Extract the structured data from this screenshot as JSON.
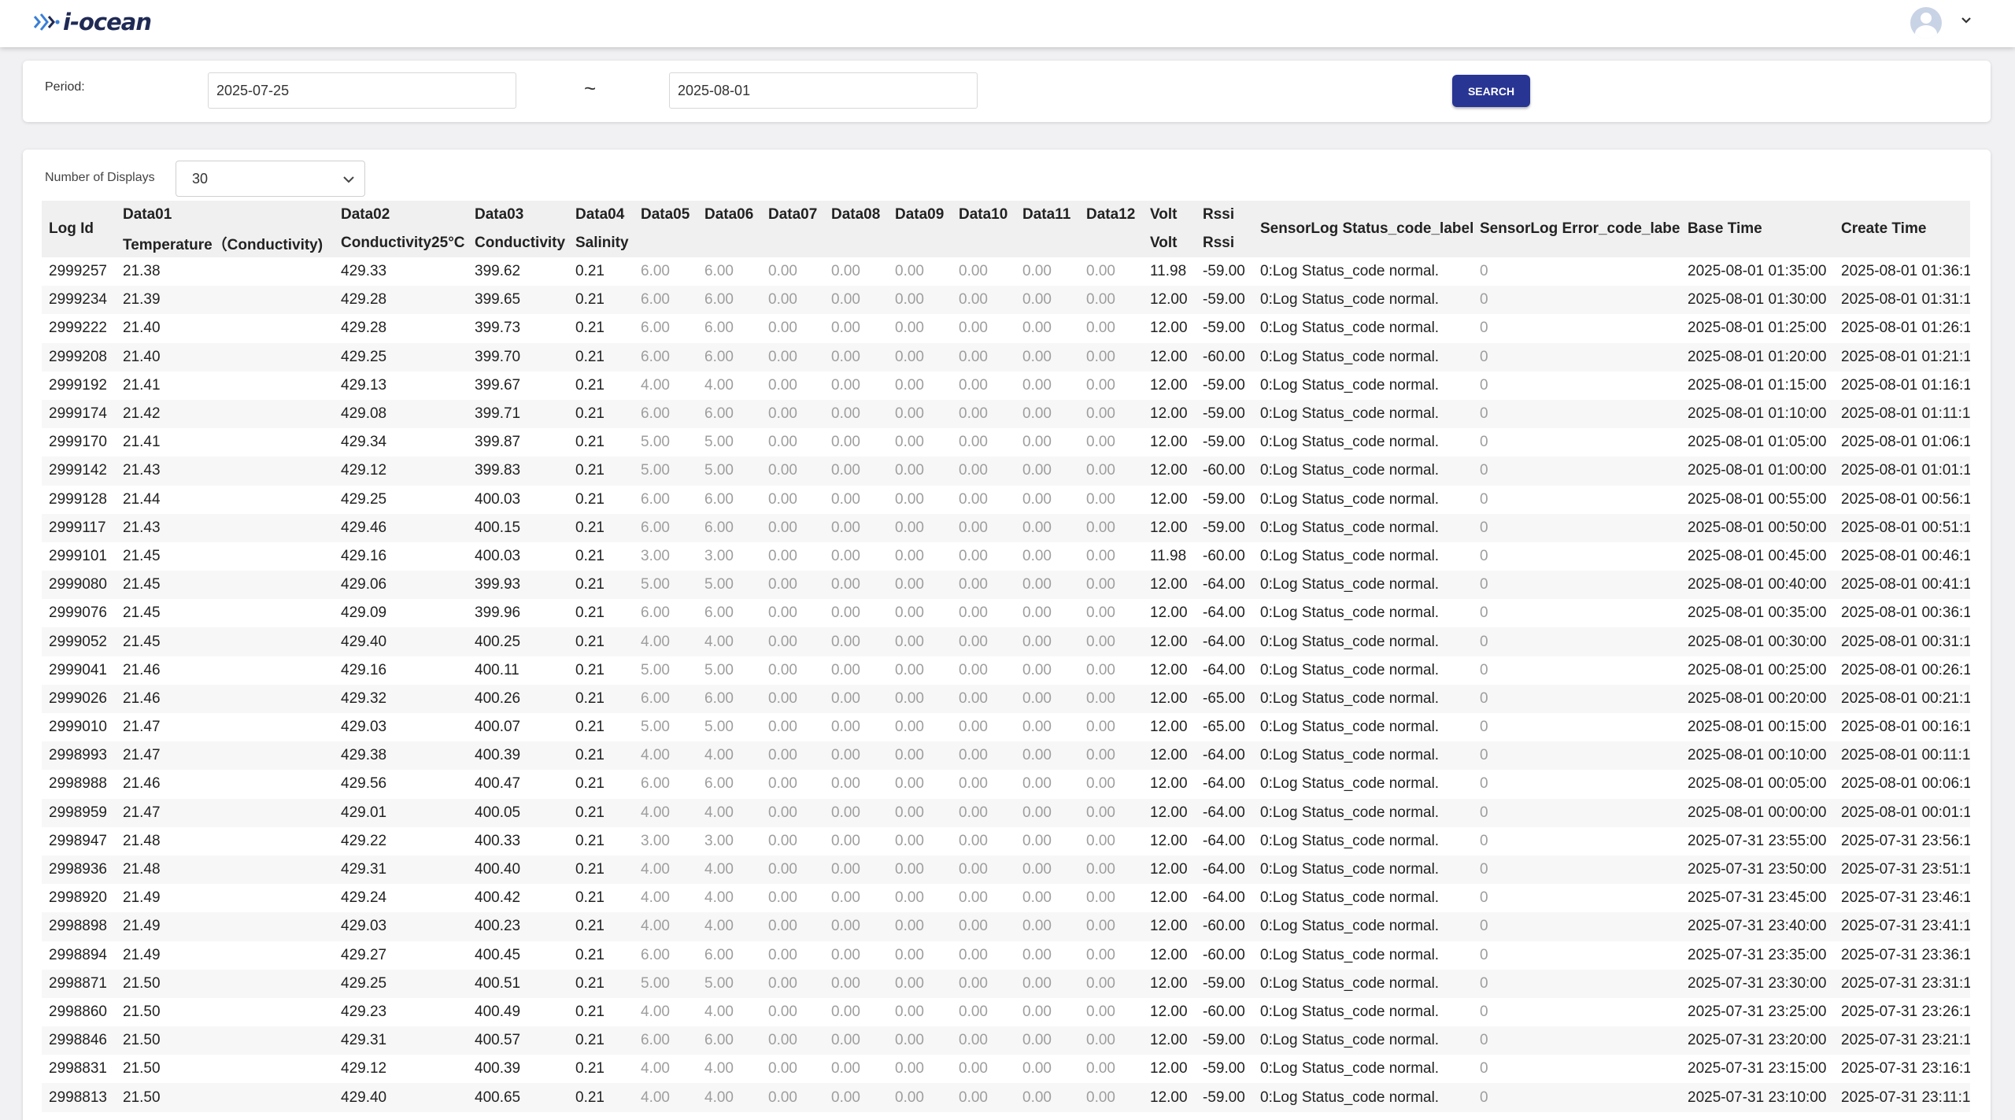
{
  "brand": {
    "name": "i-ocean"
  },
  "search": {
    "period_label": "Period:",
    "from_value": "2025-07-25",
    "separator": "~",
    "to_value": "2025-08-01",
    "button_label": "SEARCH"
  },
  "displays": {
    "label": "Number of Displays",
    "value": "30"
  },
  "table": {
    "headers": {
      "log_id": "Log Id",
      "data01": "Data01",
      "data01_sub": "Temperature（Conductivity)",
      "data02": "Data02",
      "data02_sub": "Conductivity25°C",
      "data03": "Data03",
      "data03_sub": "Conductivity",
      "data04": "Data04",
      "data04_sub": "Salinity",
      "data05": "Data05",
      "data06": "Data06",
      "data07": "Data07",
      "data08": "Data08",
      "data09": "Data09",
      "data10": "Data10",
      "data11": "Data11",
      "data12": "Data12",
      "volt": "Volt",
      "volt_sub": "Volt",
      "rssi": "Rssi",
      "rssi_sub": "Rssi",
      "status": "SensorLog Status_code_label.",
      "error": "SensorLog Error_code_label.",
      "base_time": "Base Time",
      "create_time": "Create Time"
    },
    "rows": [
      [
        "2999257",
        "21.38",
        "429.33",
        "399.62",
        "0.21",
        "6.00",
        "6.00",
        "0.00",
        "0.00",
        "0.00",
        "0.00",
        "0.00",
        "0.00",
        "11.98",
        "-59.00",
        "0:Log Status_code normal.",
        "0",
        "2025-08-01 01:35:00",
        "2025-08-01 01:36:1"
      ],
      [
        "2999234",
        "21.39",
        "429.28",
        "399.65",
        "0.21",
        "6.00",
        "6.00",
        "0.00",
        "0.00",
        "0.00",
        "0.00",
        "0.00",
        "0.00",
        "12.00",
        "-59.00",
        "0:Log Status_code normal.",
        "0",
        "2025-08-01 01:30:00",
        "2025-08-01 01:31:1"
      ],
      [
        "2999222",
        "21.40",
        "429.28",
        "399.73",
        "0.21",
        "6.00",
        "6.00",
        "0.00",
        "0.00",
        "0.00",
        "0.00",
        "0.00",
        "0.00",
        "12.00",
        "-59.00",
        "0:Log Status_code normal.",
        "0",
        "2025-08-01 01:25:00",
        "2025-08-01 01:26:1"
      ],
      [
        "2999208",
        "21.40",
        "429.25",
        "399.70",
        "0.21",
        "6.00",
        "6.00",
        "0.00",
        "0.00",
        "0.00",
        "0.00",
        "0.00",
        "0.00",
        "12.00",
        "-60.00",
        "0:Log Status_code normal.",
        "0",
        "2025-08-01 01:20:00",
        "2025-08-01 01:21:1"
      ],
      [
        "2999192",
        "21.41",
        "429.13",
        "399.67",
        "0.21",
        "4.00",
        "4.00",
        "0.00",
        "0.00",
        "0.00",
        "0.00",
        "0.00",
        "0.00",
        "12.00",
        "-59.00",
        "0:Log Status_code normal.",
        "0",
        "2025-08-01 01:15:00",
        "2025-08-01 01:16:1"
      ],
      [
        "2999174",
        "21.42",
        "429.08",
        "399.71",
        "0.21",
        "6.00",
        "6.00",
        "0.00",
        "0.00",
        "0.00",
        "0.00",
        "0.00",
        "0.00",
        "12.00",
        "-59.00",
        "0:Log Status_code normal.",
        "0",
        "2025-08-01 01:10:00",
        "2025-08-01 01:11:1"
      ],
      [
        "2999170",
        "21.41",
        "429.34",
        "399.87",
        "0.21",
        "5.00",
        "5.00",
        "0.00",
        "0.00",
        "0.00",
        "0.00",
        "0.00",
        "0.00",
        "12.00",
        "-59.00",
        "0:Log Status_code normal.",
        "0",
        "2025-08-01 01:05:00",
        "2025-08-01 01:06:1"
      ],
      [
        "2999142",
        "21.43",
        "429.12",
        "399.83",
        "0.21",
        "5.00",
        "5.00",
        "0.00",
        "0.00",
        "0.00",
        "0.00",
        "0.00",
        "0.00",
        "12.00",
        "-60.00",
        "0:Log Status_code normal.",
        "0",
        "2025-08-01 01:00:00",
        "2025-08-01 01:01:1"
      ],
      [
        "2999128",
        "21.44",
        "429.25",
        "400.03",
        "0.21",
        "6.00",
        "6.00",
        "0.00",
        "0.00",
        "0.00",
        "0.00",
        "0.00",
        "0.00",
        "12.00",
        "-59.00",
        "0:Log Status_code normal.",
        "0",
        "2025-08-01 00:55:00",
        "2025-08-01 00:56:1"
      ],
      [
        "2999117",
        "21.43",
        "429.46",
        "400.15",
        "0.21",
        "6.00",
        "6.00",
        "0.00",
        "0.00",
        "0.00",
        "0.00",
        "0.00",
        "0.00",
        "12.00",
        "-59.00",
        "0:Log Status_code normal.",
        "0",
        "2025-08-01 00:50:00",
        "2025-08-01 00:51:1"
      ],
      [
        "2999101",
        "21.45",
        "429.16",
        "400.03",
        "0.21",
        "3.00",
        "3.00",
        "0.00",
        "0.00",
        "0.00",
        "0.00",
        "0.00",
        "0.00",
        "11.98",
        "-60.00",
        "0:Log Status_code normal.",
        "0",
        "2025-08-01 00:45:00",
        "2025-08-01 00:46:1"
      ],
      [
        "2999080",
        "21.45",
        "429.06",
        "399.93",
        "0.21",
        "5.00",
        "5.00",
        "0.00",
        "0.00",
        "0.00",
        "0.00",
        "0.00",
        "0.00",
        "12.00",
        "-64.00",
        "0:Log Status_code normal.",
        "0",
        "2025-08-01 00:40:00",
        "2025-08-01 00:41:1"
      ],
      [
        "2999076",
        "21.45",
        "429.09",
        "399.96",
        "0.21",
        "6.00",
        "6.00",
        "0.00",
        "0.00",
        "0.00",
        "0.00",
        "0.00",
        "0.00",
        "12.00",
        "-64.00",
        "0:Log Status_code normal.",
        "0",
        "2025-08-01 00:35:00",
        "2025-08-01 00:36:1"
      ],
      [
        "2999052",
        "21.45",
        "429.40",
        "400.25",
        "0.21",
        "4.00",
        "4.00",
        "0.00",
        "0.00",
        "0.00",
        "0.00",
        "0.00",
        "0.00",
        "12.00",
        "-64.00",
        "0:Log Status_code normal.",
        "0",
        "2025-08-01 00:30:00",
        "2025-08-01 00:31:1"
      ],
      [
        "2999041",
        "21.46",
        "429.16",
        "400.11",
        "0.21",
        "5.00",
        "5.00",
        "0.00",
        "0.00",
        "0.00",
        "0.00",
        "0.00",
        "0.00",
        "12.00",
        "-64.00",
        "0:Log Status_code normal.",
        "0",
        "2025-08-01 00:25:00",
        "2025-08-01 00:26:1"
      ],
      [
        "2999026",
        "21.46",
        "429.32",
        "400.26",
        "0.21",
        "6.00",
        "6.00",
        "0.00",
        "0.00",
        "0.00",
        "0.00",
        "0.00",
        "0.00",
        "12.00",
        "-65.00",
        "0:Log Status_code normal.",
        "0",
        "2025-08-01 00:20:00",
        "2025-08-01 00:21:1"
      ],
      [
        "2999010",
        "21.47",
        "429.03",
        "400.07",
        "0.21",
        "5.00",
        "5.00",
        "0.00",
        "0.00",
        "0.00",
        "0.00",
        "0.00",
        "0.00",
        "12.00",
        "-65.00",
        "0:Log Status_code normal.",
        "0",
        "2025-08-01 00:15:00",
        "2025-08-01 00:16:1"
      ],
      [
        "2998993",
        "21.47",
        "429.38",
        "400.39",
        "0.21",
        "4.00",
        "4.00",
        "0.00",
        "0.00",
        "0.00",
        "0.00",
        "0.00",
        "0.00",
        "12.00",
        "-64.00",
        "0:Log Status_code normal.",
        "0",
        "2025-08-01 00:10:00",
        "2025-08-01 00:11:1"
      ],
      [
        "2998988",
        "21.46",
        "429.56",
        "400.47",
        "0.21",
        "6.00",
        "6.00",
        "0.00",
        "0.00",
        "0.00",
        "0.00",
        "0.00",
        "0.00",
        "12.00",
        "-64.00",
        "0:Log Status_code normal.",
        "0",
        "2025-08-01 00:05:00",
        "2025-08-01 00:06:1"
      ],
      [
        "2998959",
        "21.47",
        "429.01",
        "400.05",
        "0.21",
        "4.00",
        "4.00",
        "0.00",
        "0.00",
        "0.00",
        "0.00",
        "0.00",
        "0.00",
        "12.00",
        "-64.00",
        "0:Log Status_code normal.",
        "0",
        "2025-08-01 00:00:00",
        "2025-08-01 00:01:1"
      ],
      [
        "2998947",
        "21.48",
        "429.22",
        "400.33",
        "0.21",
        "3.00",
        "3.00",
        "0.00",
        "0.00",
        "0.00",
        "0.00",
        "0.00",
        "0.00",
        "12.00",
        "-64.00",
        "0:Log Status_code normal.",
        "0",
        "2025-07-31 23:55:00",
        "2025-07-31 23:56:1"
      ],
      [
        "2998936",
        "21.48",
        "429.31",
        "400.40",
        "0.21",
        "4.00",
        "4.00",
        "0.00",
        "0.00",
        "0.00",
        "0.00",
        "0.00",
        "0.00",
        "12.00",
        "-64.00",
        "0:Log Status_code normal.",
        "0",
        "2025-07-31 23:50:00",
        "2025-07-31 23:51:1"
      ],
      [
        "2998920",
        "21.49",
        "429.24",
        "400.42",
        "0.21",
        "4.00",
        "4.00",
        "0.00",
        "0.00",
        "0.00",
        "0.00",
        "0.00",
        "0.00",
        "12.00",
        "-64.00",
        "0:Log Status_code normal.",
        "0",
        "2025-07-31 23:45:00",
        "2025-07-31 23:46:1"
      ],
      [
        "2998898",
        "21.49",
        "429.03",
        "400.23",
        "0.21",
        "4.00",
        "4.00",
        "0.00",
        "0.00",
        "0.00",
        "0.00",
        "0.00",
        "0.00",
        "12.00",
        "-60.00",
        "0:Log Status_code normal.",
        "0",
        "2025-07-31 23:40:00",
        "2025-07-31 23:41:1"
      ],
      [
        "2998894",
        "21.49",
        "429.27",
        "400.45",
        "0.21",
        "6.00",
        "6.00",
        "0.00",
        "0.00",
        "0.00",
        "0.00",
        "0.00",
        "0.00",
        "12.00",
        "-60.00",
        "0:Log Status_code normal.",
        "0",
        "2025-07-31 23:35:00",
        "2025-07-31 23:36:1"
      ],
      [
        "2998871",
        "21.50",
        "429.25",
        "400.51",
        "0.21",
        "5.00",
        "5.00",
        "0.00",
        "0.00",
        "0.00",
        "0.00",
        "0.00",
        "0.00",
        "12.00",
        "-59.00",
        "0:Log Status_code normal.",
        "0",
        "2025-07-31 23:30:00",
        "2025-07-31 23:31:1"
      ],
      [
        "2998860",
        "21.50",
        "429.23",
        "400.49",
        "0.21",
        "4.00",
        "4.00",
        "0.00",
        "0.00",
        "0.00",
        "0.00",
        "0.00",
        "0.00",
        "12.00",
        "-60.00",
        "0:Log Status_code normal.",
        "0",
        "2025-07-31 23:25:00",
        "2025-07-31 23:26:1"
      ],
      [
        "2998846",
        "21.50",
        "429.31",
        "400.57",
        "0.21",
        "6.00",
        "6.00",
        "0.00",
        "0.00",
        "0.00",
        "0.00",
        "0.00",
        "0.00",
        "12.00",
        "-59.00",
        "0:Log Status_code normal.",
        "0",
        "2025-07-31 23:20:00",
        "2025-07-31 23:21:1"
      ],
      [
        "2998831",
        "21.50",
        "429.12",
        "400.39",
        "0.21",
        "4.00",
        "4.00",
        "0.00",
        "0.00",
        "0.00",
        "0.00",
        "0.00",
        "0.00",
        "12.00",
        "-59.00",
        "0:Log Status_code normal.",
        "0",
        "2025-07-31 23:15:00",
        "2025-07-31 23:16:1"
      ],
      [
        "2998813",
        "21.50",
        "429.40",
        "400.65",
        "0.21",
        "4.00",
        "4.00",
        "0.00",
        "0.00",
        "0.00",
        "0.00",
        "0.00",
        "0.00",
        "12.00",
        "-59.00",
        "0:Log Status_code normal.",
        "0",
        "2025-07-31 23:10:00",
        "2025-07-31 23:11:1"
      ]
    ]
  },
  "colors": {
    "brand_navy": "#1f2a55",
    "logo_blue": "#3b7fd6",
    "button": "#283593",
    "muted_text": "#9e9e9e",
    "header_bg": "#f0f0f0",
    "page_bg": "#f1f1f3"
  },
  "icons": {
    "logo": "i-ocean-logo-mark",
    "user": "user-avatar-icon",
    "user_menu": "chevron-down-icon",
    "select": "chevron-down-icon"
  }
}
